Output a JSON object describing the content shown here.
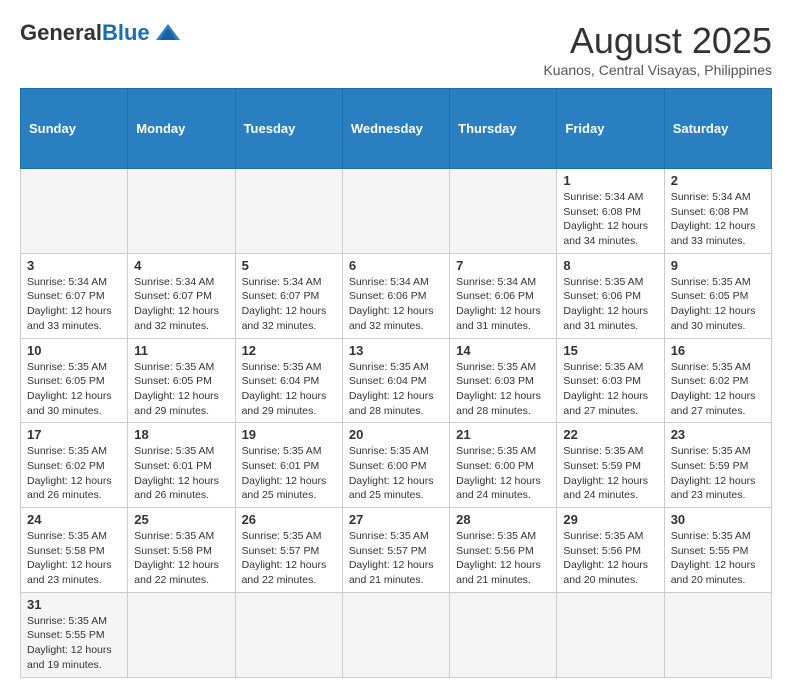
{
  "logo": {
    "general": "General",
    "blue": "Blue"
  },
  "title": "August 2025",
  "subtitle": "Kuanos, Central Visayas, Philippines",
  "days_of_week": [
    "Sunday",
    "Monday",
    "Tuesday",
    "Wednesday",
    "Thursday",
    "Friday",
    "Saturday"
  ],
  "weeks": [
    [
      {
        "day": "",
        "info": ""
      },
      {
        "day": "",
        "info": ""
      },
      {
        "day": "",
        "info": ""
      },
      {
        "day": "",
        "info": ""
      },
      {
        "day": "",
        "info": ""
      },
      {
        "day": "1",
        "info": "Sunrise: 5:34 AM\nSunset: 6:08 PM\nDaylight: 12 hours\nand 34 minutes."
      },
      {
        "day": "2",
        "info": "Sunrise: 5:34 AM\nSunset: 6:08 PM\nDaylight: 12 hours\nand 33 minutes."
      }
    ],
    [
      {
        "day": "3",
        "info": "Sunrise: 5:34 AM\nSunset: 6:07 PM\nDaylight: 12 hours\nand 33 minutes."
      },
      {
        "day": "4",
        "info": "Sunrise: 5:34 AM\nSunset: 6:07 PM\nDaylight: 12 hours\nand 32 minutes."
      },
      {
        "day": "5",
        "info": "Sunrise: 5:34 AM\nSunset: 6:07 PM\nDaylight: 12 hours\nand 32 minutes."
      },
      {
        "day": "6",
        "info": "Sunrise: 5:34 AM\nSunset: 6:06 PM\nDaylight: 12 hours\nand 32 minutes."
      },
      {
        "day": "7",
        "info": "Sunrise: 5:34 AM\nSunset: 6:06 PM\nDaylight: 12 hours\nand 31 minutes."
      },
      {
        "day": "8",
        "info": "Sunrise: 5:35 AM\nSunset: 6:06 PM\nDaylight: 12 hours\nand 31 minutes."
      },
      {
        "day": "9",
        "info": "Sunrise: 5:35 AM\nSunset: 6:05 PM\nDaylight: 12 hours\nand 30 minutes."
      }
    ],
    [
      {
        "day": "10",
        "info": "Sunrise: 5:35 AM\nSunset: 6:05 PM\nDaylight: 12 hours\nand 30 minutes."
      },
      {
        "day": "11",
        "info": "Sunrise: 5:35 AM\nSunset: 6:05 PM\nDaylight: 12 hours\nand 29 minutes."
      },
      {
        "day": "12",
        "info": "Sunrise: 5:35 AM\nSunset: 6:04 PM\nDaylight: 12 hours\nand 29 minutes."
      },
      {
        "day": "13",
        "info": "Sunrise: 5:35 AM\nSunset: 6:04 PM\nDaylight: 12 hours\nand 28 minutes."
      },
      {
        "day": "14",
        "info": "Sunrise: 5:35 AM\nSunset: 6:03 PM\nDaylight: 12 hours\nand 28 minutes."
      },
      {
        "day": "15",
        "info": "Sunrise: 5:35 AM\nSunset: 6:03 PM\nDaylight: 12 hours\nand 27 minutes."
      },
      {
        "day": "16",
        "info": "Sunrise: 5:35 AM\nSunset: 6:02 PM\nDaylight: 12 hours\nand 27 minutes."
      }
    ],
    [
      {
        "day": "17",
        "info": "Sunrise: 5:35 AM\nSunset: 6:02 PM\nDaylight: 12 hours\nand 26 minutes."
      },
      {
        "day": "18",
        "info": "Sunrise: 5:35 AM\nSunset: 6:01 PM\nDaylight: 12 hours\nand 26 minutes."
      },
      {
        "day": "19",
        "info": "Sunrise: 5:35 AM\nSunset: 6:01 PM\nDaylight: 12 hours\nand 25 minutes."
      },
      {
        "day": "20",
        "info": "Sunrise: 5:35 AM\nSunset: 6:00 PM\nDaylight: 12 hours\nand 25 minutes."
      },
      {
        "day": "21",
        "info": "Sunrise: 5:35 AM\nSunset: 6:00 PM\nDaylight: 12 hours\nand 24 minutes."
      },
      {
        "day": "22",
        "info": "Sunrise: 5:35 AM\nSunset: 5:59 PM\nDaylight: 12 hours\nand 24 minutes."
      },
      {
        "day": "23",
        "info": "Sunrise: 5:35 AM\nSunset: 5:59 PM\nDaylight: 12 hours\nand 23 minutes."
      }
    ],
    [
      {
        "day": "24",
        "info": "Sunrise: 5:35 AM\nSunset: 5:58 PM\nDaylight: 12 hours\nand 23 minutes."
      },
      {
        "day": "25",
        "info": "Sunrise: 5:35 AM\nSunset: 5:58 PM\nDaylight: 12 hours\nand 22 minutes."
      },
      {
        "day": "26",
        "info": "Sunrise: 5:35 AM\nSunset: 5:57 PM\nDaylight: 12 hours\nand 22 minutes."
      },
      {
        "day": "27",
        "info": "Sunrise: 5:35 AM\nSunset: 5:57 PM\nDaylight: 12 hours\nand 21 minutes."
      },
      {
        "day": "28",
        "info": "Sunrise: 5:35 AM\nSunset: 5:56 PM\nDaylight: 12 hours\nand 21 minutes."
      },
      {
        "day": "29",
        "info": "Sunrise: 5:35 AM\nSunset: 5:56 PM\nDaylight: 12 hours\nand 20 minutes."
      },
      {
        "day": "30",
        "info": "Sunrise: 5:35 AM\nSunset: 5:55 PM\nDaylight: 12 hours\nand 20 minutes."
      }
    ],
    [
      {
        "day": "31",
        "info": "Sunrise: 5:35 AM\nSunset: 5:55 PM\nDaylight: 12 hours\nand 19 minutes."
      },
      {
        "day": "",
        "info": ""
      },
      {
        "day": "",
        "info": ""
      },
      {
        "day": "",
        "info": ""
      },
      {
        "day": "",
        "info": ""
      },
      {
        "day": "",
        "info": ""
      },
      {
        "day": "",
        "info": ""
      }
    ]
  ]
}
